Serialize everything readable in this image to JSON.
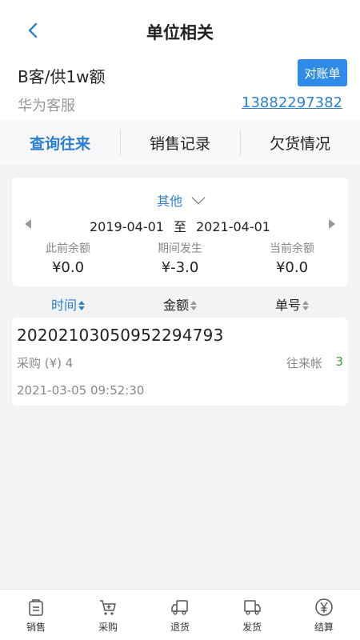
{
  "header": {
    "title": "单位相关"
  },
  "unit": {
    "name": "B客/供1w额",
    "reconcile_label": "对账单",
    "service": "华为客服",
    "phone": "13882297382"
  },
  "tabs": [
    {
      "label": "查询往来",
      "active": true
    },
    {
      "label": "销售记录",
      "active": false
    },
    {
      "label": "欠货情况",
      "active": false
    }
  ],
  "filter": {
    "period_type": "其他",
    "start_date": "2019-04-01",
    "separator": "至",
    "end_date": "2021-04-01",
    "balances": [
      {
        "label": "此前余额",
        "value": "¥0.0"
      },
      {
        "label": "期间发生",
        "value": "¥-3.0"
      },
      {
        "label": "当前余额",
        "value": "¥0.0"
      }
    ]
  },
  "sort": [
    {
      "label": "时间",
      "active": true
    },
    {
      "label": "金额",
      "active": false
    },
    {
      "label": "单号",
      "active": false
    }
  ],
  "records": [
    {
      "order_no": "20202103050952294793",
      "type_text": "采购 (¥) 4",
      "category": "往来帐",
      "amount": "3",
      "time": "2021-03-05 09:52:30"
    }
  ],
  "nav": [
    {
      "label": "销售",
      "icon": "sales-icon"
    },
    {
      "label": "采购",
      "icon": "purchase-cart-icon"
    },
    {
      "label": "退货",
      "icon": "return-truck-icon"
    },
    {
      "label": "发货",
      "icon": "delivery-truck-icon"
    },
    {
      "label": "结算",
      "icon": "yen-settle-icon"
    }
  ],
  "colors": {
    "accent": "#2f7fd1",
    "button": "#2f8be8",
    "positive": "#3a9c3a"
  }
}
